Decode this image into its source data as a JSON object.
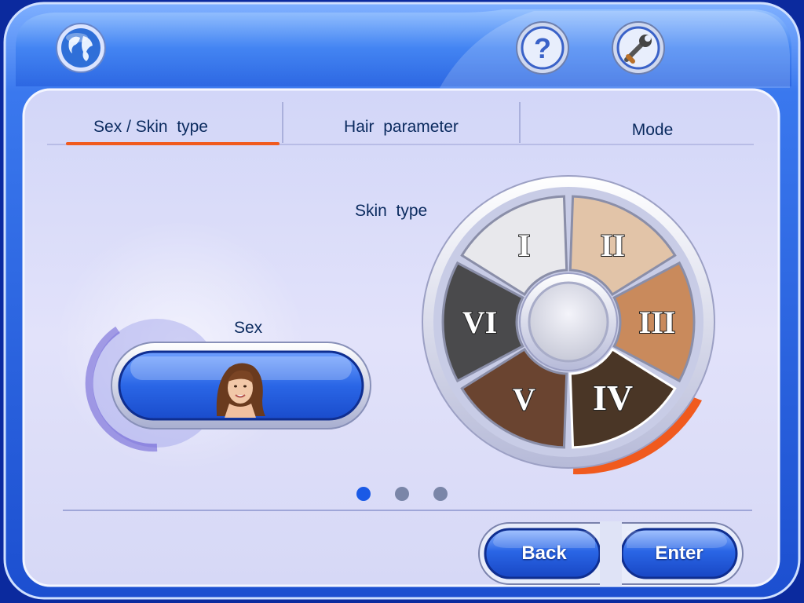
{
  "tabs": [
    {
      "label": "Sex / Skin  type",
      "active": true
    },
    {
      "label": "Hair  parameter",
      "active": false
    },
    {
      "label": "Mode",
      "active": false
    }
  ],
  "sex": {
    "label": "Sex",
    "selected": "female"
  },
  "skin": {
    "label": "Skin  type",
    "selected": "IV",
    "types": [
      {
        "numeral": "I",
        "color": "#e8e8ec"
      },
      {
        "numeral": "II",
        "color": "#e2c4a8"
      },
      {
        "numeral": "III",
        "color": "#c98a5c"
      },
      {
        "numeral": "IV",
        "color": "#4a3626"
      },
      {
        "numeral": "V",
        "color": "#6a4430"
      },
      {
        "numeral": "VI",
        "color": "#4a4a4c"
      }
    ]
  },
  "pager": {
    "pages": 3,
    "current": 1
  },
  "buttons": {
    "back": "Back",
    "enter": "Enter"
  },
  "icons": {
    "top_left": "globe-icon",
    "help": "help-icon",
    "settings": "tools-icon"
  },
  "colors": {
    "accent": "#f05a1e",
    "frame": "#2e6fe0",
    "panel": "#dcdcf6",
    "button": "#1f5fd8"
  }
}
